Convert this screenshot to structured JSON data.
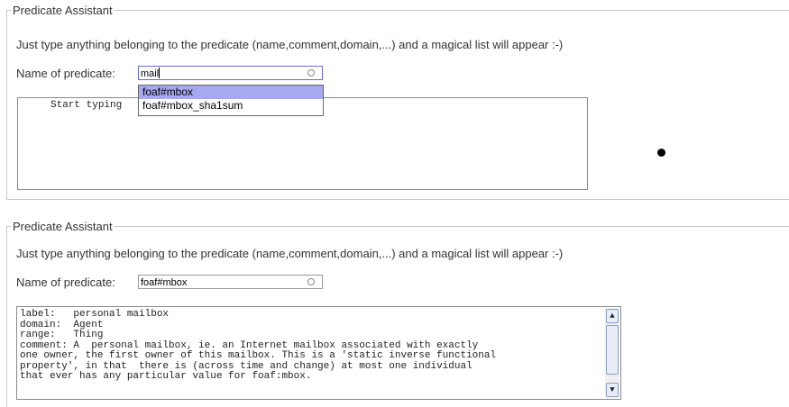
{
  "panel_top": {
    "legend": "Predicate Assistant",
    "intro": "Just type anything belonging to the predicate (name,comment,domain,...) and a magical list will appear :-)",
    "name_label": "Name of predicate:",
    "input_value": "mail",
    "textbox_text": "     Start typing",
    "suggestions": [
      "foaf#mbox",
      "foaf#mbox_sha1sum"
    ],
    "selected_suggestion": "foaf#mbox"
  },
  "panel_bottom": {
    "legend": "Predicate Assistant",
    "intro": "Just type anything belonging to the predicate (name,comment,domain,...) and a magical list will appear :-)",
    "name_label": "Name of predicate:",
    "input_value": "foaf#mbox",
    "textbox_lines": [
      "label:   personal mailbox",
      "domain:  Agent",
      "range:   Thing",
      "comment: A  personal mailbox, ie. an Internet mailbox associated with exactly",
      "one owner, the first owner of this mailbox. This is a 'static inverse functional",
      "property', in that  there is (across time and change) at most one individual",
      "that ever has any particular value for foaf:mbox."
    ]
  },
  "icons": {
    "clear": "circle-clear-icon",
    "scroll_up": "arrow-up-icon",
    "scroll_down": "arrow-down-icon",
    "cursor": "dot-cursor-icon"
  }
}
